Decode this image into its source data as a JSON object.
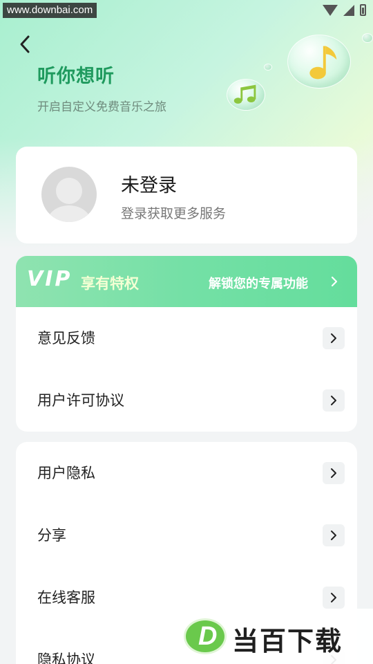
{
  "status_bar": {
    "watermark_url": "www.downbai.com",
    "icons": [
      "wifi-icon",
      "signal-icon",
      "battery-icon"
    ]
  },
  "header": {
    "back_icon": "chevron-left-icon",
    "title": "听你想听",
    "subtitle": "开启自定义免费音乐之旅",
    "decoration_icons": [
      "music-note-icon",
      "music-notes-icon"
    ]
  },
  "profile": {
    "name": "未登录",
    "description": "登录获取更多服务",
    "avatar_icon": "default-avatar-icon"
  },
  "vip_banner": {
    "logo": "VIP",
    "privilege": "享有特权",
    "unlock": "解锁您的专属功能",
    "chevron_icon": "chevron-right-icon"
  },
  "menu_group_1": [
    {
      "label": "意见反馈"
    },
    {
      "label": "用户许可协议"
    }
  ],
  "menu_group_2": [
    {
      "label": "用户隐私"
    },
    {
      "label": "分享"
    },
    {
      "label": "在线客服"
    },
    {
      "label": "隐私协议"
    }
  ],
  "corner_watermark": {
    "mark": "D",
    "brand": "当百下载"
  },
  "colors": {
    "title_green": "#1f9a5e",
    "vip_green": "#74e0a6",
    "background": "#f2f4f5"
  }
}
